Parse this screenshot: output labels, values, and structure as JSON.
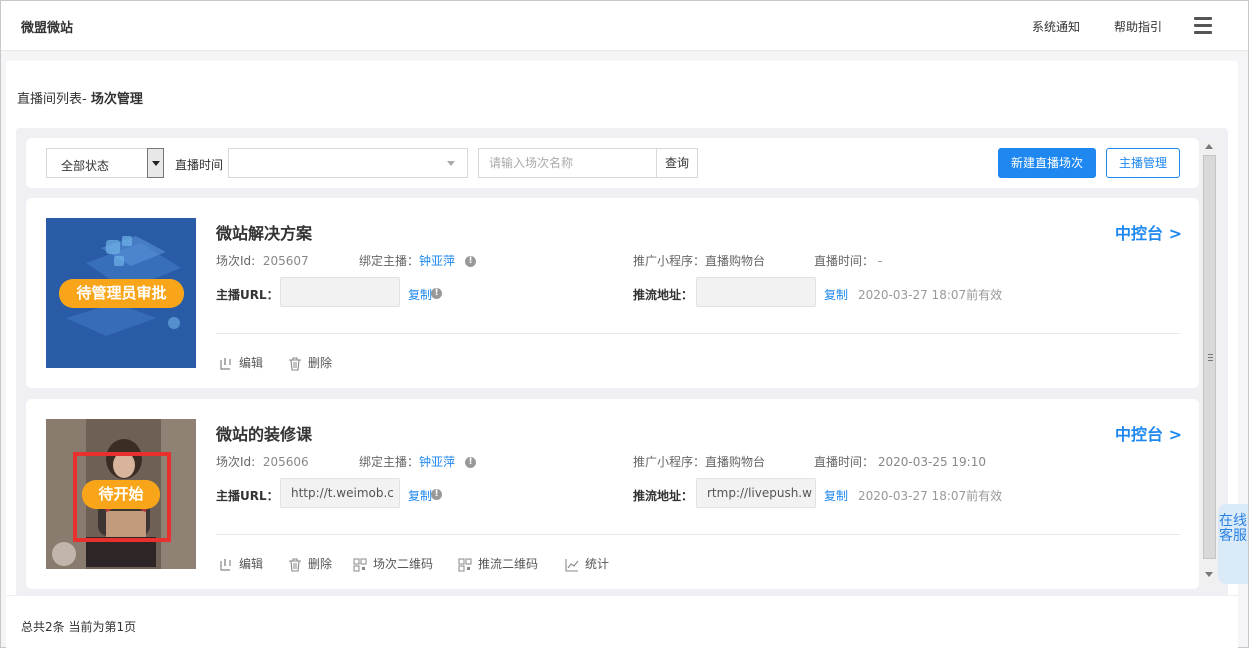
{
  "header": {
    "brand": "微盟微站",
    "links": [
      "系统通知",
      "帮助指引"
    ]
  },
  "breadcrumb": {
    "prefix": "直播间列表- ",
    "current": "场次管理"
  },
  "filter": {
    "status_value": "全部状态",
    "time_label": "直播时间",
    "time_value": "",
    "search_placeholder": "请输入场次名称",
    "query_label": "查询",
    "new_session_label": "新建直播场次",
    "anchor_manage_label": "主播管理"
  },
  "labels": {
    "session_id": "场次Id:",
    "anchor": "绑定主播：",
    "mini_program": "推广小程序：",
    "live_time": "直播时间：",
    "anchor_url": "主播URL：",
    "push_url": "推流地址：",
    "copy": "复制",
    "console": "中控台 >",
    "info": "!"
  },
  "sessions": [
    {
      "status": "待管理员审批",
      "title": "微站解决方案",
      "id": "205607",
      "anchor": "钟亚萍",
      "mini_program": "直播购物台",
      "live_time": "-",
      "anchor_url": "",
      "push_url": "",
      "valid_until": "2020-03-27 18:07前有效",
      "actions": [
        "编辑",
        "删除"
      ]
    },
    {
      "status": "待开始",
      "title": "微站的装修课",
      "id": "205606",
      "anchor": "钟亚萍",
      "mini_program": "直播购物台",
      "live_time": "2020-03-25 19:10",
      "anchor_url": "http://t.weimob.c",
      "push_url": "rtmp://livepush.w",
      "valid_until": "2020-03-27 18:07前有效",
      "actions": [
        "编辑",
        "删除",
        "场次二维码",
        "推流二维码",
        "统计"
      ]
    }
  ],
  "footer": {
    "summary": "总共2条 当前为第1页"
  },
  "service_tab": "在线客服",
  "colors": {
    "accent": "#1e88f0",
    "status_badge": "#f9a51a",
    "highlight_box": "#e8302e"
  }
}
